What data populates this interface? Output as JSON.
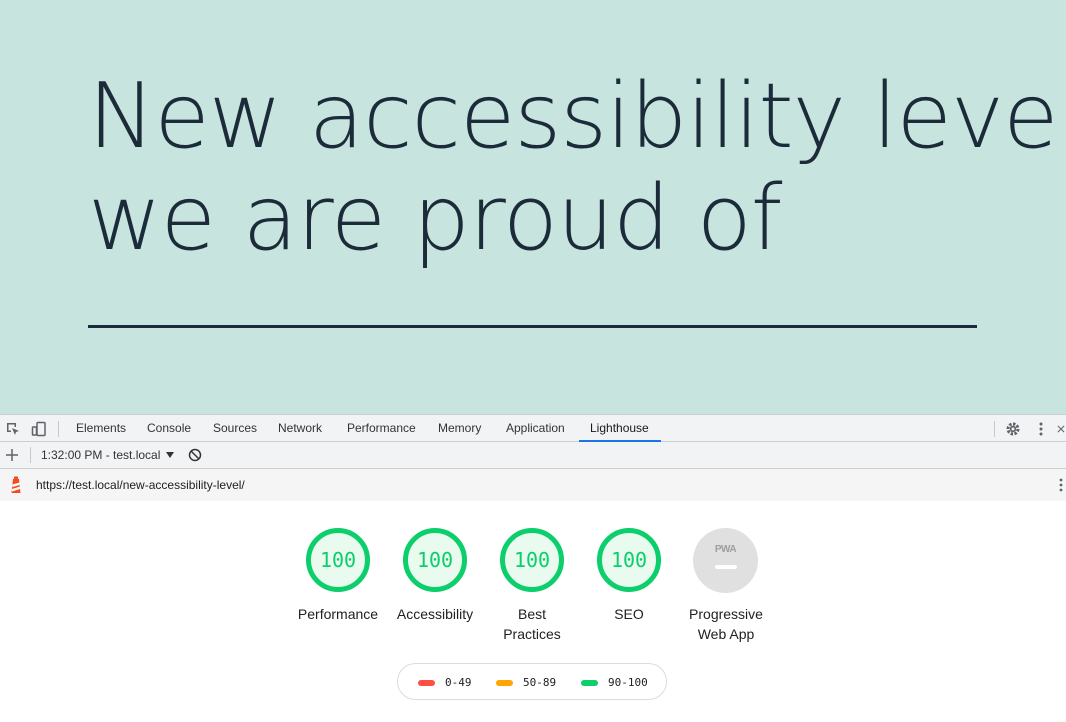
{
  "page": {
    "title_line1": "New accessibility level",
    "title_line2": "we are proud of",
    "background_color": "#c8e4de",
    "text_color": "#1c2b39"
  },
  "devtools": {
    "tabs": [
      {
        "label": "Elements"
      },
      {
        "label": "Console"
      },
      {
        "label": "Sources"
      },
      {
        "label": "Network"
      },
      {
        "label": "Performance"
      },
      {
        "label": "Memory"
      },
      {
        "label": "Application"
      },
      {
        "label": "Lighthouse",
        "active": true
      }
    ],
    "accent_color": "#1a73e8",
    "icons": [
      "inspect-element-icon",
      "device-toolbar-icon",
      "settings-gear-icon",
      "more-vertical-icon",
      "close-icon"
    ]
  },
  "lighthouse": {
    "report_select": "1:32:00 PM - test.local",
    "url": "https://test.local/new-accessibility-level/",
    "scores": [
      {
        "label": "Performance",
        "value": "100"
      },
      {
        "label": "Accessibility",
        "value": "100"
      },
      {
        "label": "Best Practices",
        "value": "100"
      },
      {
        "label": "SEO",
        "value": "100"
      }
    ],
    "pwa": {
      "badge": "PWA",
      "label": "Progressive Web App"
    },
    "pass_color": "#0cce6b",
    "legend": [
      {
        "range": "0-49",
        "color": "#ff4e42"
      },
      {
        "range": "50-89",
        "color": "#ffa400"
      },
      {
        "range": "90-100",
        "color": "#0cce6b"
      }
    ]
  }
}
